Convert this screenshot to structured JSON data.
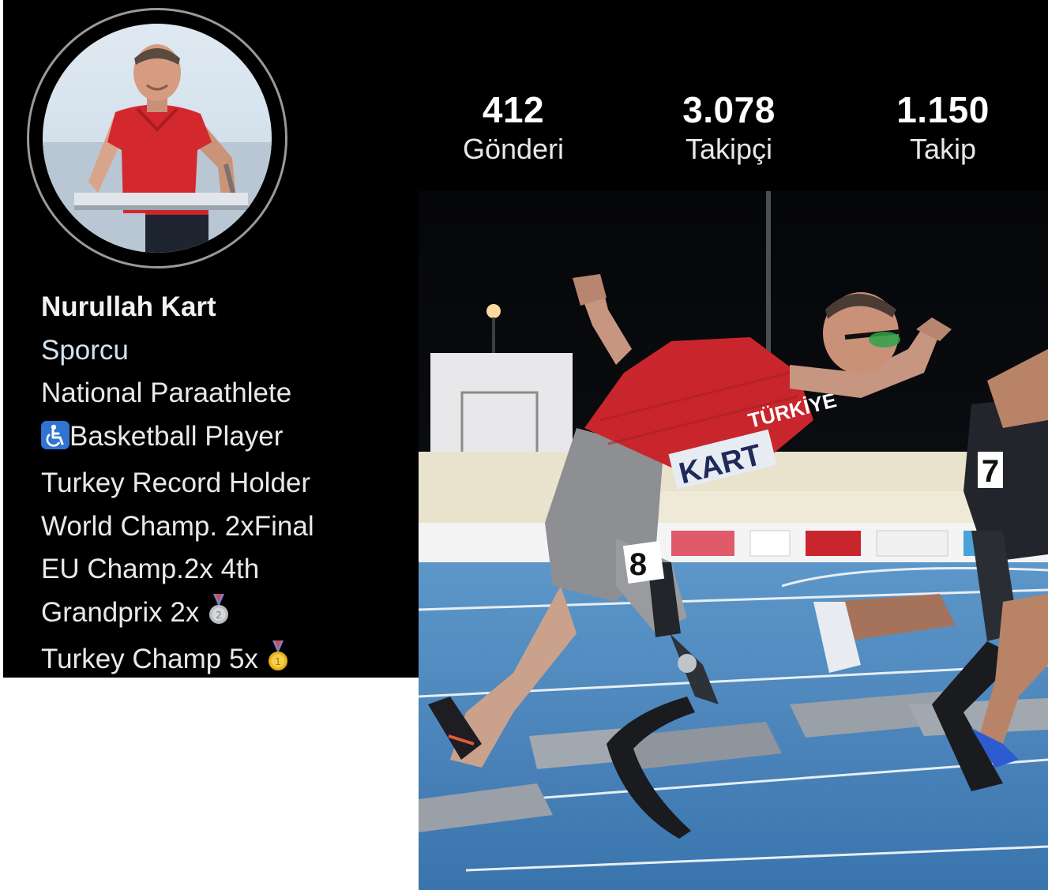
{
  "stats": {
    "posts": {
      "count": "412",
      "label": "Gönderi"
    },
    "followers": {
      "count": "3.078",
      "label": "Takipçi"
    },
    "following": {
      "count": "1.150",
      "label": "Takip"
    }
  },
  "profile": {
    "name": "Nurullah Kart",
    "category": "Sporcu",
    "bio_lines": [
      "National Paraathlete",
      "Basketball Player",
      "Turkey Record Holder",
      "World Champ. 2xFinal",
      "EU Champ.2x 4th",
      "Grandprix 2x",
      "Turkey Champ 5x"
    ]
  },
  "photo": {
    "jersey_text": "TÜRKİYE",
    "bib_name": "KART",
    "leg_bib_number": "8",
    "other_runner_bib": "7"
  },
  "icons": {
    "bio_line_2": "wheelchair-icon",
    "bio_line_6": "silver-medal-icon",
    "bio_line_7": "gold-medal-icon"
  },
  "colors": {
    "background": "#000000",
    "text": "#e9e9e9",
    "jersey_red": "#c8262c",
    "track_blue": "#3f7fb8",
    "wheelchair_blue": "#2f74d0",
    "silver": "#b9bcc2",
    "gold": "#e8b21c"
  }
}
